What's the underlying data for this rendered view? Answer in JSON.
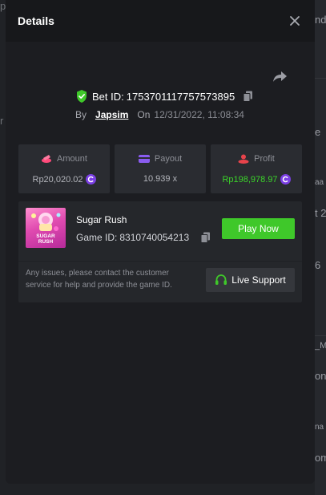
{
  "background": {
    "fragments": [
      "nd",
      "e",
      "aa",
      "t 2",
      "6",
      "_M",
      "onu",
      "na",
      "om"
    ],
    "left_fragments": [
      "p",
      "r"
    ]
  },
  "modal": {
    "title": "Details",
    "close_icon": "close-icon",
    "share_icon": "share-arrow-icon"
  },
  "bet": {
    "label": "Bet ID:",
    "id": "1753701117757573895",
    "by_label": "By",
    "username": "Japsim",
    "on_label": "On",
    "date": "12/31/2022, 11:08:34"
  },
  "stats": {
    "amount": {
      "label": "Amount",
      "value": "Rp20,020.02",
      "icon": "coins-icon"
    },
    "payout": {
      "label": "Payout",
      "value": "10.939 x",
      "icon": "wallet-icon"
    },
    "profit": {
      "label": "Profit",
      "value": "Rp198,978.97",
      "icon": "profit-coins-icon"
    }
  },
  "game": {
    "title": "Sugar Rush",
    "id_label": "Game ID:",
    "id": "8310740054213",
    "thumb_text": "SUGAR RUSH",
    "play_label": "Play Now",
    "help_text": "Any issues, please contact the customer service for help and provide the game ID.",
    "support_label": "Live Support"
  },
  "colors": {
    "accent_green": "#3fc82a",
    "profit_green": "#3bd42a",
    "coin_purple": "#7b3fe4",
    "shield_green": "#3fc82a",
    "amount_pink": "#ff4a7a",
    "payout_purple": "#8a5cf0",
    "profit_red": "#e8434b"
  }
}
